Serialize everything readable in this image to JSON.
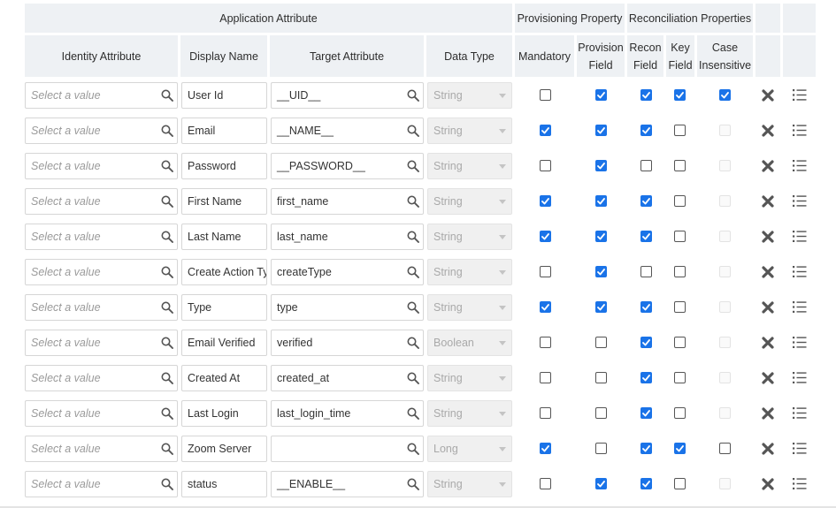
{
  "headers": {
    "application_attribute": "Application Attribute",
    "provisioning_property": "Provisioning Property",
    "reconciliation_properties": "Reconciliation Properties",
    "identity_attribute": "Identity Attribute",
    "display_name": "Display Name",
    "target_attribute": "Target Attribute",
    "data_type": "Data Type",
    "mandatory": "Mandatory",
    "provision_field_line1": "Provision",
    "provision_field_line2": "Field",
    "recon_field_line1": "Recon",
    "recon_field_line2": "Field",
    "key_field_line1": "Key",
    "key_field_line2": "Field",
    "case_insensitive_line1": "Case",
    "case_insensitive_line2": "Insensitive"
  },
  "identity_placeholder": "Select a value",
  "rows": [
    {
      "display_name": "User Id",
      "target": "__UID__",
      "type": "String",
      "mandatory": false,
      "provision": true,
      "recon": true,
      "key": true,
      "case": "on"
    },
    {
      "display_name": "Email",
      "target": "__NAME__",
      "type": "String",
      "mandatory": true,
      "provision": true,
      "recon": true,
      "key": false,
      "case": "disabled"
    },
    {
      "display_name": "Password",
      "target": "__PASSWORD__",
      "type": "String",
      "mandatory": false,
      "provision": true,
      "recon": false,
      "key": false,
      "case": "disabled"
    },
    {
      "display_name": "First Name",
      "target": "first_name",
      "type": "String",
      "mandatory": true,
      "provision": true,
      "recon": true,
      "key": false,
      "case": "disabled"
    },
    {
      "display_name": "Last Name",
      "target": "last_name",
      "type": "String",
      "mandatory": true,
      "provision": true,
      "recon": true,
      "key": false,
      "case": "disabled"
    },
    {
      "display_name": "Create Action Ty",
      "target": "createType",
      "type": "String",
      "mandatory": false,
      "provision": true,
      "recon": false,
      "key": false,
      "case": "disabled"
    },
    {
      "display_name": "Type",
      "target": "type",
      "type": "String",
      "mandatory": true,
      "provision": true,
      "recon": true,
      "key": false,
      "case": "disabled"
    },
    {
      "display_name": "Email Verified",
      "target": "verified",
      "type": "Boolean",
      "mandatory": false,
      "provision": false,
      "recon": true,
      "key": false,
      "case": "disabled"
    },
    {
      "display_name": "Created At",
      "target": "created_at",
      "type": "String",
      "mandatory": false,
      "provision": false,
      "recon": true,
      "key": false,
      "case": "disabled"
    },
    {
      "display_name": "Last Login",
      "target": "last_login_time",
      "type": "String",
      "mandatory": false,
      "provision": false,
      "recon": true,
      "key": false,
      "case": "disabled"
    },
    {
      "display_name": "Zoom Server",
      "target": "",
      "type": "Long",
      "mandatory": true,
      "provision": false,
      "recon": true,
      "key": true,
      "case": "off"
    },
    {
      "display_name": "status",
      "target": "__ENABLE__",
      "type": "String",
      "mandatory": false,
      "provision": true,
      "recon": true,
      "key": false,
      "case": "disabled"
    }
  ],
  "colors": {
    "accent": "#1a73e8",
    "header_bg": "#eef1f4",
    "delete_icon": "#555555"
  },
  "icons": {
    "search": "search-icon",
    "dropdown": "chevron-down-icon",
    "delete": "delete-icon",
    "details": "list-details-icon"
  }
}
